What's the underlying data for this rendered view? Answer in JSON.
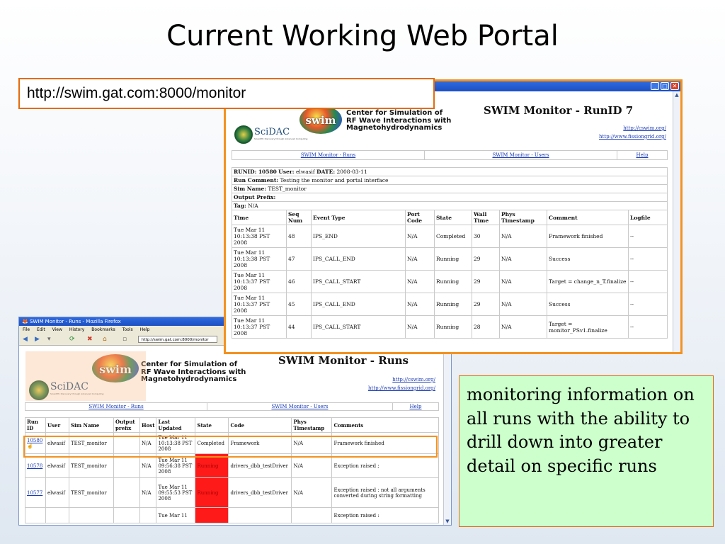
{
  "slide": {
    "title": "Current Working Web Portal",
    "url_label": "http://swim.gat.com:8000/monitor",
    "note": "monitoring information on all runs with the ability to drill down into greater detail on specific runs"
  },
  "colors": {
    "accent_orange": "#e46c0a",
    "note_bg": "#ccffcc",
    "running_red": "#ff1a1a",
    "link_blue": "#1a3bb5"
  },
  "header": {
    "logo_text": "swim",
    "scidac_text": "SciDAC",
    "scidac_sub": "Scientific Discovery through Advanced Computing",
    "center_name_lines": [
      "Center for Simulation of",
      "RF Wave Interactions with",
      "Magnetohydrodynamics"
    ],
    "link_cswim": "http://cswim.org/",
    "link_fission": "http://www.fissiongrid.org/"
  },
  "runid_window": {
    "title": "SWIM Monitor - RunID 7",
    "nav": [
      "SWIM Monitor - Runs",
      "SWIM Monitor - Users",
      "Help"
    ],
    "info_user_prefix": "User:",
    "info": {
      "runid_label": "RUNID:",
      "runid": "10580",
      "user_label": "User:",
      "user": "elwasif",
      "date_label": "DATE:",
      "date": "2008-03-11",
      "run_comment_label": "Run Comment:",
      "run_comment": "Testing the monitor and portal interface",
      "sim_name_label": "Sim Name:",
      "sim_name": "TEST_monitor",
      "output_prefix_label": "Output Prefix:",
      "tag_label": "Tag:",
      "tag": "N/A"
    },
    "columns": [
      "Time",
      "Seq Num",
      "Event Type",
      "Port Code",
      "State",
      "Wall Time",
      "Phys Timestamp",
      "Comment",
      "Logfile"
    ],
    "rows": [
      [
        "Tue Mar 11 10:13:38 PST 2008",
        "48",
        "IPS_END",
        "N/A",
        "Completed",
        "30",
        "N/A",
        "Framework finished",
        "--"
      ],
      [
        "Tue Mar 11 10:13:38 PST 2008",
        "47",
        "IPS_CALL_END",
        "N/A",
        "Running",
        "29",
        "N/A",
        "Success",
        "--"
      ],
      [
        "Tue Mar 11 10:13:37 PST 2008",
        "46",
        "IPS_CALL_START",
        "N/A",
        "Running",
        "29",
        "N/A",
        "Target = change_n_T.finalize",
        "--"
      ],
      [
        "Tue Mar 11 10:13:37 PST 2008",
        "45",
        "IPS_CALL_END",
        "N/A",
        "Running",
        "29",
        "N/A",
        "Success",
        "--"
      ],
      [
        "Tue Mar 11 10:13:37 PST 2008",
        "44",
        "IPS_CALL_START",
        "N/A",
        "Running",
        "28",
        "N/A",
        "Target = monitor_PSv1.finalize",
        "--"
      ]
    ]
  },
  "runs_window": {
    "window_title": "SWIM Monitor - Runs - Mozilla Firefox",
    "menu": [
      "File",
      "Edit",
      "View",
      "History",
      "Bookmarks",
      "Tools",
      "Help"
    ],
    "address": "http://swim.gat.com:8000/monitor",
    "title": "SWIM Monitor - Runs",
    "nav": [
      "SWIM Monitor - Runs",
      "SWIM Monitor - Users",
      "Help"
    ],
    "columns": [
      "Run ID",
      "User",
      "Sim Name",
      "Output prefix",
      "Host",
      "Last Updated",
      "State",
      "Code",
      "Phys Timestamp",
      "Comments"
    ],
    "rows": [
      [
        "10580",
        "elwasif",
        "TEST_monitor",
        "",
        "N/A",
        "Tue Mar 11 10:13:38 PST 2008",
        "Completed",
        "Framework",
        "N/A",
        "Framework finished"
      ],
      [
        "10578",
        "elwasif",
        "TEST_monitor",
        "",
        "N/A",
        "Tue Mar 11 09:56:38 PST 2008",
        "Running",
        "drivers_dbb_testDriver",
        "N/A",
        "Exception raised ;"
      ],
      [
        "10577",
        "elwasif",
        "TEST_monitor",
        "",
        "N/A",
        "Tue Mar 11 09:55:53 PST 2008",
        "Running",
        "drivers_dbb_testDriver",
        "N/A",
        "Exception raised : not all arguments converted during string formatting"
      ],
      [
        "",
        "",
        "",
        "",
        "",
        "Tue Mar 11",
        "",
        "",
        "",
        "Exception raised :"
      ]
    ]
  }
}
